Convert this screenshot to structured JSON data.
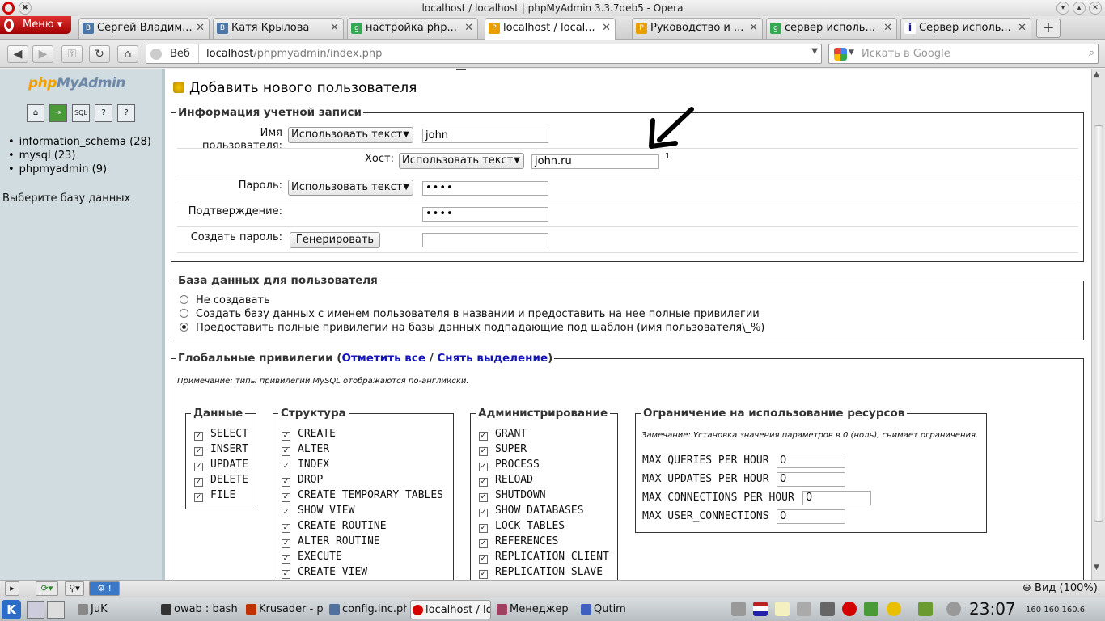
{
  "window": {
    "title": "localhost / localhost | phpMyAdmin 3.3.7deb5 - Opera"
  },
  "browser": {
    "menu_label": "Меню",
    "tabs": [
      {
        "label": "Сергей Владим...",
        "icon": "vk-icon",
        "color": "#4a76a8"
      },
      {
        "label": "Катя Крылова",
        "icon": "vk-icon",
        "color": "#4a76a8"
      },
      {
        "label": "настройка php...",
        "icon": "google-icon",
        "color": "#34a853"
      },
      {
        "label": "localhost / local...",
        "icon": "pma-icon",
        "color": "#e8a000"
      },
      {
        "label": "Руководство и ...",
        "icon": "pma-icon",
        "color": "#e8a000"
      },
      {
        "label": "сервер исполь...",
        "icon": "google-icon",
        "color": "#34a853"
      },
      {
        "label": "Сервер исполь...",
        "icon": "info-icon",
        "color": "#1a1a8a"
      }
    ],
    "address_mode": "Веб",
    "url_host": "localhost",
    "url_path": "/phpmyadmin/index.php",
    "search_placeholder": "Искать в Google"
  },
  "sidebar": {
    "logo_php": "php",
    "logo_my": "My",
    "logo_admin": "Admin",
    "databases": [
      "information_schema (28)",
      "mysql (23)",
      "phpmyadmin (9)"
    ],
    "choose_db": "Выберите базу данных"
  },
  "page": {
    "title": "Добавить нового пользователя",
    "login": {
      "legend": "Информация учетной записи",
      "username_label_1": "Имя",
      "username_label_2": "пользователя:",
      "username_select": "Использовать текст",
      "username_value": "john",
      "host_label": "Хост:",
      "host_select": "Использовать текст",
      "host_value": "john.ru",
      "host_footnote": "1",
      "password_label": "Пароль:",
      "password_select": "Использовать текст",
      "password_value": "••••",
      "confirm_label": "Подтверждение:",
      "confirm_value": "••••",
      "generate_label": "Создать пароль:",
      "generate_button": "Генерировать"
    },
    "database": {
      "legend": "База данных для пользователя",
      "options": [
        {
          "label": "Не создавать",
          "checked": false
        },
        {
          "label": "Создать базу данных с именем пользователя в названии и предоставить на нее полные привилегии",
          "checked": false
        },
        {
          "label": "Предоставить полные привилегии на базы данных подпадающие под шаблон (имя пользователя\\_%)",
          "checked": true
        }
      ]
    },
    "privileges": {
      "legend_prefix": "Глобальные привилегии (",
      "check_all": "Отметить все",
      "sep": " / ",
      "uncheck_all": "Снять выделение",
      "legend_suffix": ")",
      "note": "Примечание: типы привилегий MySQL отображаются по-английски.",
      "data": {
        "legend": "Данные",
        "items": [
          "SELECT",
          "INSERT",
          "UPDATE",
          "DELETE",
          "FILE"
        ]
      },
      "structure": {
        "legend": "Структура",
        "items": [
          "CREATE",
          "ALTER",
          "INDEX",
          "DROP",
          "CREATE TEMPORARY TABLES",
          "SHOW VIEW",
          "CREATE ROUTINE",
          "ALTER ROUTINE",
          "EXECUTE",
          "CREATE VIEW"
        ]
      },
      "admin": {
        "legend": "Администрирование",
        "items": [
          "GRANT",
          "SUPER",
          "PROCESS",
          "RELOAD",
          "SHUTDOWN",
          "SHOW DATABASES",
          "LOCK TABLES",
          "REFERENCES",
          "REPLICATION CLIENT",
          "REPLICATION SLAVE"
        ]
      },
      "limits": {
        "legend": "Ограничение на использование ресурсов",
        "note": "Замечание: Установка значения параметров в 0 (ноль), снимает ограничения.",
        "items": [
          {
            "label": "MAX QUERIES PER HOUR",
            "value": "0"
          },
          {
            "label": "MAX UPDATES PER HOUR",
            "value": "0"
          },
          {
            "label": "MAX CONNECTIONS PER HOUR",
            "value": "0"
          },
          {
            "label": "MAX USER_CONNECTIONS",
            "value": "0"
          }
        ]
      }
    }
  },
  "statusbar": {
    "zoom": "Вид (100%)"
  },
  "taskbar": {
    "tasks": [
      {
        "label": "JuK",
        "color": "#888888"
      },
      {
        "label": "owab : bash",
        "color": "#333333"
      },
      {
        "label": "Krusader - p",
        "color": "#c03000"
      },
      {
        "label": "config.inc.ph",
        "color": "#5070a0"
      },
      {
        "label": "localhost / lo",
        "color": "#d40000"
      },
      {
        "label": "Менеджер",
        "color": "#a04060"
      },
      {
        "label": "Qutim",
        "color": "#4060c0"
      }
    ],
    "clock": "23:07",
    "tray_text": "160 160 160.6"
  },
  "colors": {
    "accent_link": "#1515b8",
    "sidebar_bg": "#d0dce0",
    "opera_red": "#d40000"
  }
}
